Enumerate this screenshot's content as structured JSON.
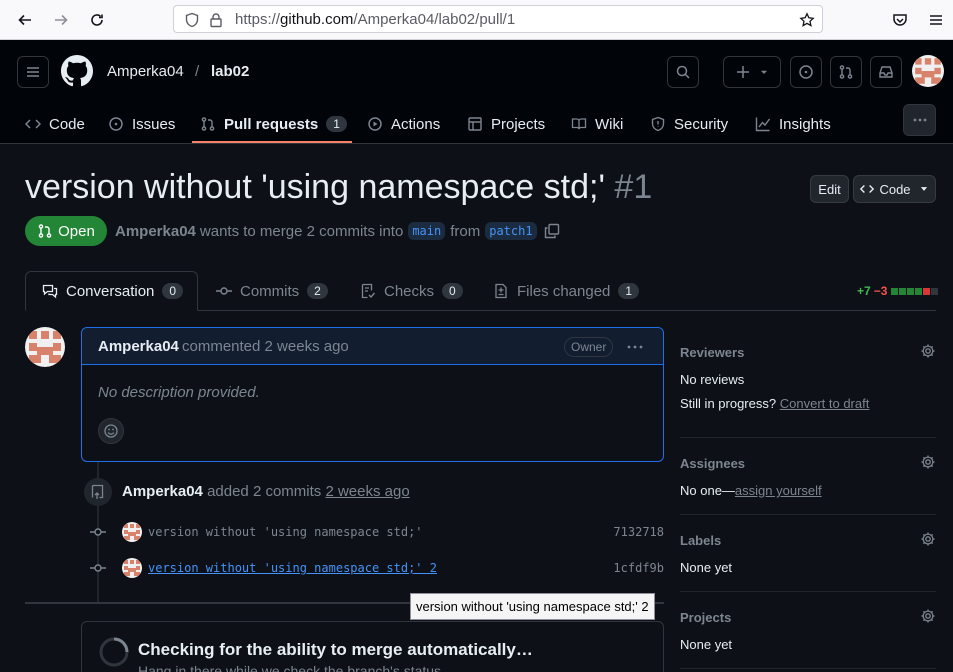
{
  "browser": {
    "url_prefix": "https://",
    "url_host": "github.com",
    "url_path": "/Amperka04/lab02/pull/1"
  },
  "header": {
    "owner": "Amperka04",
    "separator": "/",
    "repo": "lab02"
  },
  "repo_nav": [
    {
      "label": "Code",
      "icon": "code-icon"
    },
    {
      "label": "Issues",
      "icon": "issue-icon"
    },
    {
      "label": "Pull requests",
      "icon": "pull-request-icon",
      "count": "1",
      "active": true
    },
    {
      "label": "Actions",
      "icon": "play-icon"
    },
    {
      "label": "Projects",
      "icon": "table-icon"
    },
    {
      "label": "Wiki",
      "icon": "book-icon"
    },
    {
      "label": "Security",
      "icon": "shield-icon"
    },
    {
      "label": "Insights",
      "icon": "graph-icon"
    }
  ],
  "pr": {
    "title": "version without 'using namespace std;'",
    "number": "#1",
    "edit_label": "Edit",
    "code_label": "Code",
    "state": "Open",
    "author": "Amperka04",
    "meta_text": "wants to merge 2 commits into",
    "base_branch": "main",
    "from_text": "from",
    "head_branch": "patch1"
  },
  "tabs": [
    {
      "label": "Conversation",
      "count": "0"
    },
    {
      "label": "Commits",
      "count": "2"
    },
    {
      "label": "Checks",
      "count": "0"
    },
    {
      "label": "Files changed",
      "count": "1"
    }
  ],
  "diffstat": {
    "additions": "+7",
    "deletions": "−3",
    "colors": [
      "#238636",
      "#238636",
      "#238636",
      "#238636",
      "#da3633",
      "#30363d"
    ]
  },
  "comment": {
    "author": "Amperka04",
    "action": "commented 2 weeks ago",
    "badge": "Owner",
    "body": "No description provided."
  },
  "push_event": {
    "author": "Amperka04",
    "text": "added 2 commits",
    "time": "2 weeks ago"
  },
  "commits": [
    {
      "message": "version without 'using namespace std;'",
      "sha": "7132718"
    },
    {
      "message": "version without 'using namespace std;' 2",
      "sha": "1cfdf9b"
    }
  ],
  "tooltip": "version without 'using namespace std;' 2",
  "merge": {
    "title": "Checking for the ability to merge automatically…",
    "subtitle": "Hang in there while we check the branch's status."
  },
  "sidebar": {
    "reviewers": {
      "title": "Reviewers",
      "value": "No reviews",
      "progress_text": "Still in progress?",
      "progress_link": "Convert to draft"
    },
    "assignees": {
      "title": "Assignees",
      "value_prefix": "No one—",
      "value_link": "assign yourself"
    },
    "labels": {
      "title": "Labels",
      "value": "None yet"
    },
    "projects": {
      "title": "Projects",
      "value": "None yet"
    }
  },
  "colors": {
    "accent_link": "#4493f8",
    "open_green": "#238636",
    "tab_underline": "#f78166",
    "avatar_fg": "#d9826b"
  }
}
